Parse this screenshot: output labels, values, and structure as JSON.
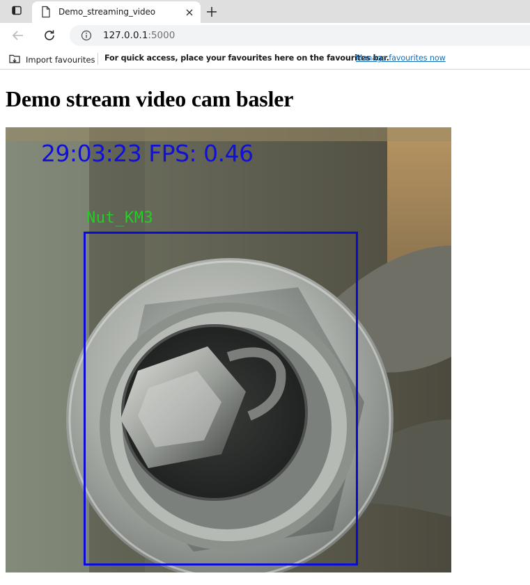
{
  "browser": {
    "tab": {
      "title": "Demo_streaming_video"
    },
    "address": {
      "host": "127.0.0.1",
      "port": ":5000"
    },
    "favourites_bar": {
      "import_label": "Import favourites",
      "message": "For quick access, place your favourites here on the favourites bar.",
      "manage_link": "Manage favourites now"
    },
    "icons": {
      "tab_actions": "tab-actions-icon",
      "page": "page-icon",
      "close": "close-icon",
      "new_tab": "plus-icon",
      "back": "back-arrow-icon",
      "reload": "reload-icon",
      "site_info": "info-icon",
      "import": "import-icon"
    }
  },
  "page": {
    "heading": "Demo stream video cam basler",
    "video": {
      "timestamp": "29:03:23 FPS: 0.46",
      "detection_label": "Nut_KM3",
      "box_color": "#0b0bd6",
      "label_color": "#22d022",
      "timestamp_color": "#1010d8"
    }
  }
}
